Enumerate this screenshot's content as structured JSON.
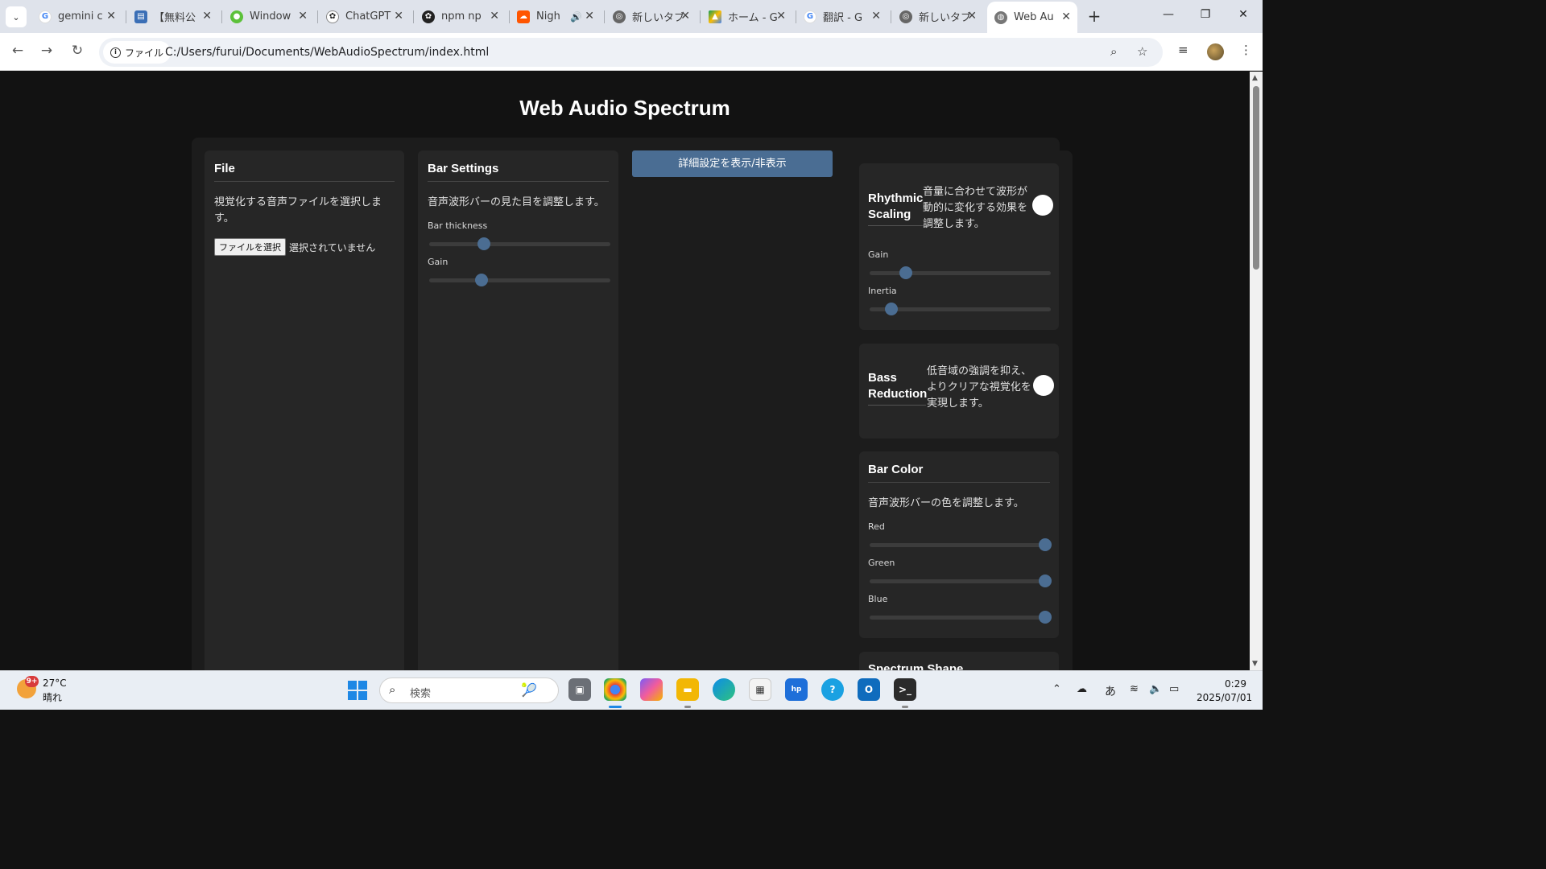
{
  "browser": {
    "tabs": [
      {
        "label": "gemini c",
        "icon": "google-icon"
      },
      {
        "label": "【無料公",
        "icon": "document-icon"
      },
      {
        "label": "Window",
        "icon": "green-circle-icon"
      },
      {
        "label": "ChatGPT",
        "icon": "chatgpt-icon"
      },
      {
        "label": "npm np",
        "icon": "openai-icon"
      },
      {
        "label": "Nigh",
        "icon": "soundcloud-icon"
      },
      {
        "label": "新しいタブ",
        "icon": "chrome-icon"
      },
      {
        "label": "ホーム - G",
        "icon": "drive-icon"
      },
      {
        "label": "翻訳 - G",
        "icon": "google-icon"
      },
      {
        "label": "新しいタブ",
        "icon": "chrome-icon"
      },
      {
        "label": "Web Au",
        "icon": "globe-icon",
        "active": true
      }
    ],
    "site_chip": "ファイル",
    "url": "C:/Users/furui/Documents/WebAudioSpectrum/index.html"
  },
  "page": {
    "title": "Web Audio Spectrum",
    "file_panel": {
      "title": "File",
      "description": "視覚化する音声ファイルを選択します。",
      "button": "ファイルを選択",
      "no_file": "選択されていません"
    },
    "bar_settings": {
      "title": "Bar Settings",
      "description": "音声波形バーの見た目を調整します。",
      "sliders": [
        {
          "label": "Bar thickness",
          "fraction": 0.3
        },
        {
          "label": "Gain",
          "fraction": 0.29
        }
      ]
    },
    "toggle_advanced": "詳細設定を表示/非表示",
    "rhythmic": {
      "title_line1": "Rhythmic",
      "title_line2": "Scaling",
      "description": "音量に合わせて波形が動的に変化する効果を調整します。",
      "sliders": [
        {
          "label": "Gain",
          "fraction": 0.2
        },
        {
          "label": "Inertia",
          "fraction": 0.12
        }
      ]
    },
    "bass": {
      "title_line1": "Bass",
      "title_line2": "Reduction",
      "description": "低音域の強調を抑え、よりクリアな視覚化を実現します。"
    },
    "bar_color": {
      "title": "Bar Color",
      "description": "音声波形バーの色を調整します。",
      "sliders": [
        {
          "label": "Red",
          "fraction": 0.97
        },
        {
          "label": "Green",
          "fraction": 0.97
        },
        {
          "label": "Blue",
          "fraction": 0.97
        }
      ]
    },
    "spectrum_shape": "Spectrum Shape"
  },
  "taskbar": {
    "weather_badge": "9+",
    "temperature": "27°C",
    "condition": "晴れ",
    "search_placeholder": "検索",
    "ime": "あ",
    "time": "0:29",
    "date": "2025/07/01"
  }
}
